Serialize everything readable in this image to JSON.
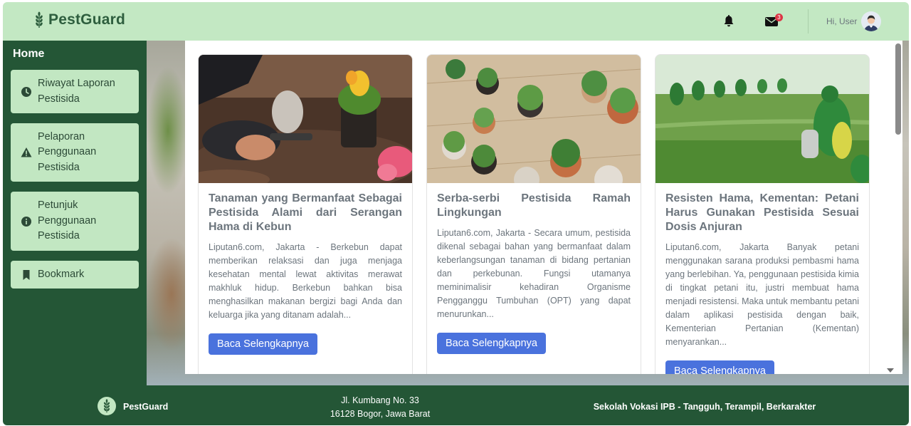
{
  "header": {
    "brand": "PestGuard",
    "mail_badge": "3",
    "greeting": "Hi, User"
  },
  "sidebar": {
    "home": "Home",
    "items": [
      {
        "label": "Riwayat Laporan Pestisida",
        "icon": "clock-icon"
      },
      {
        "label": "Pelaporan Penggunaan Pestisida",
        "icon": "warning-icon"
      },
      {
        "label": "Petunjuk Penggunaan Pestisida",
        "icon": "info-icon"
      },
      {
        "label": "Bookmark",
        "icon": "bookmark-icon"
      }
    ]
  },
  "cards": [
    {
      "title": "Tanaman yang Bermanfaat Sebagai Pestisida Alami dari Serangan Hama di Kebun",
      "text": "Liputan6.com, Jakarta - Berkebun dapat memberikan relaksasi dan juga menjaga kesehatan mental lewat aktivitas merawat makhluk hidup. Berkebun bahkan bisa menghasilkan makanan bergizi bagi Anda dan keluarga jika yang ditanam adalah...",
      "button": "Baca Selengkapnya"
    },
    {
      "title": "Serba-serbi Pestisida Ramah Lingkungan",
      "text": "Liputan6.com, Jakarta - Secara umum, pestisida dikenal sebagai bahan yang bermanfaat dalam keberlangsungan tanaman di bidang pertanian dan perkebunan. Fungsi utamanya meminimalisir kehadiran Organisme Pengganggu Tumbuhan (OPT) yang dapat menurunkan...",
      "button": "Baca Selengkapnya"
    },
    {
      "title": "Resisten Hama, Kementan: Petani Harus Gunakan Pestisida Sesuai Dosis Anjuran",
      "text": "Liputan6.com, Jakarta Banyak petani menggunakan sarana produksi pembasmi hama yang berlebihan. Ya, penggunaan pestisida kimia di tingkat petani itu, justri membuat hama menjadi resistensi. Maka untuk membantu petani dalam aplikasi pestisida dengan baik, Kementerian Pertanian (Kementan) menyarankan...",
      "button": "Baca Selengkapnya"
    }
  ],
  "footer": {
    "brand": "PestGuard",
    "address_line1": "Jl. Kumbang No. 33",
    "address_line2": "16128 Bogor, Jawa Barat",
    "tagline": "Sekolah Vokasi IPB - Tangguh, Terampil, Berkarakter"
  },
  "colors": {
    "header_bg": "#c3e8c3",
    "sidebar_bg": "#245636",
    "nav_item_bg": "#c2e7c2",
    "button_bg": "#4a72dd",
    "badge_bg": "#dc3545"
  }
}
